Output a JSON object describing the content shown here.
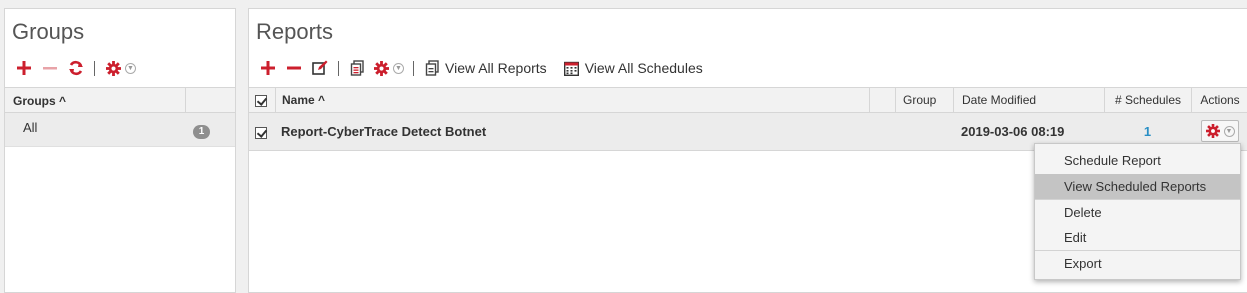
{
  "groups": {
    "title": "Groups",
    "toolbar": {
      "add_icon": "plus-icon",
      "remove_icon": "minus-icon",
      "refresh_icon": "refresh-icon",
      "settings_icon": "gear-icon"
    },
    "table": {
      "header": "Groups ^",
      "rows": [
        {
          "label": "All",
          "count": "1"
        }
      ]
    }
  },
  "reports": {
    "title": "Reports",
    "toolbar": {
      "view_all_reports": "View All Reports",
      "view_all_schedules": "View All Schedules"
    },
    "table": {
      "columns": {
        "name": "Name ^",
        "group": "Group",
        "date_modified": "Date Modified",
        "schedules": "# Schedules",
        "actions": "Actions"
      },
      "rows": [
        {
          "name": "Report-CyberTrace Detect Botnet",
          "group": "",
          "date_modified": "2019-03-06 08:19",
          "schedules": "1",
          "checked": true
        }
      ]
    }
  },
  "menu": {
    "items": [
      {
        "label": "Schedule Report"
      },
      {
        "label": "View Scheduled Reports",
        "highlighted": true
      },
      {
        "label": "Delete"
      },
      {
        "label": "Edit"
      },
      {
        "label": "Export"
      }
    ]
  },
  "colors": {
    "accent_red": "#cc1f2d",
    "link_blue": "#2a8fc5",
    "badge_gray": "#8f8f8f"
  }
}
